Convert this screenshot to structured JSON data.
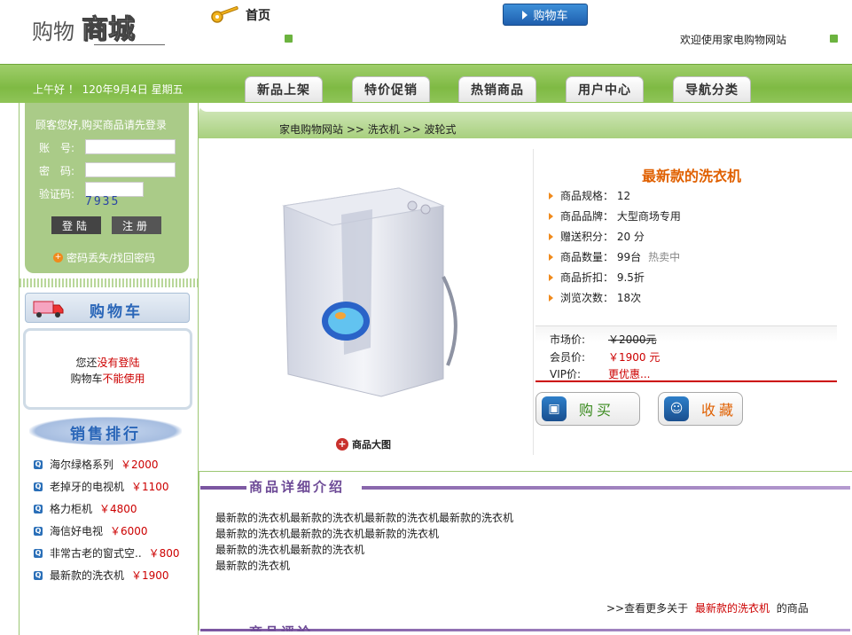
{
  "header": {
    "logo_text": "购物商城",
    "logo_main": "购物",
    "logo_accent": "商城",
    "home_label": "首页",
    "cart_button": "购物车",
    "welcome": "欢迎使用家电购物网站"
  },
  "navbar": {
    "date": "上午好 ！ 120年9月4日 星期五",
    "tabs": [
      "新品上架",
      "特价促销",
      "热销商品",
      "用户中心",
      "导航分类"
    ]
  },
  "login": {
    "hint": "顾客您好,购买商品请先登录",
    "account_label": "账　号:",
    "password_label": "密　码:",
    "captcha_label": "验证码:",
    "captcha_value": "7935",
    "login_button": "登陆",
    "register_button": "注册",
    "forgot": "密码丢失/找回密码"
  },
  "cart": {
    "title": "购物车",
    "msg_prefix": "您还",
    "msg_red1": "没有登陆",
    "msg_line2_prefix": "购物车",
    "msg_red2": "不能使用"
  },
  "ranking": {
    "title": "销售排行",
    "items": [
      {
        "name": "海尔绿格系列",
        "price": "￥2000"
      },
      {
        "name": "老掉牙的电视机",
        "price": "￥1100"
      },
      {
        "name": "格力柜机",
        "price": "￥4800"
      },
      {
        "name": "海信好电视",
        "price": "￥6000"
      },
      {
        "name": "非常古老的窗式空..",
        "price": "￥800"
      },
      {
        "name": "最新款的洗衣机",
        "price": "￥1900"
      }
    ]
  },
  "breadcrumb": "家电购物网站 >> 洗衣机 >> 波轮式",
  "product": {
    "title": "最新款的洗衣机",
    "big_pic": "商品大图",
    "specs": [
      {
        "text": "商品规格： 12",
        "extra": ""
      },
      {
        "text": "商品品牌： 大型商场专用",
        "extra": ""
      },
      {
        "text": "赠送积分： 20 分",
        "extra": ""
      },
      {
        "text": "商品数量： 99台",
        "extra": "热卖中"
      },
      {
        "text": "商品折扣： 9.5折",
        "extra": ""
      },
      {
        "text": "浏览次数： 18次",
        "extra": ""
      }
    ],
    "market_label": "市场价:",
    "market_price": "￥2000元",
    "member_label": "会员价:",
    "member_price": "￥1900 元",
    "vip_label": "VIP价:",
    "vip_price": "更优惠...",
    "buy_button": "购买",
    "fav_button": "收藏"
  },
  "details": {
    "title": "商品详细介绍",
    "lines": [
      "最新款的洗衣机最新款的洗衣机最新款的洗衣机最新款的洗衣机",
      "最新款的洗衣机最新款的洗衣机最新款的洗衣机",
      "最新款的洗衣机最新款的洗衣机",
      "最新款的洗衣机"
    ],
    "more_prefix": ">>查看更多关于",
    "more_link": "最新款的洗衣机",
    "more_suffix": "的商品",
    "review_title": "商品评论"
  },
  "colors": {
    "nav_green": "#7fba44",
    "accent_orange": "#e06000",
    "price_red": "#cc0000",
    "link_blue": "#2a66b8",
    "detail_purple": "#6d4a96"
  }
}
